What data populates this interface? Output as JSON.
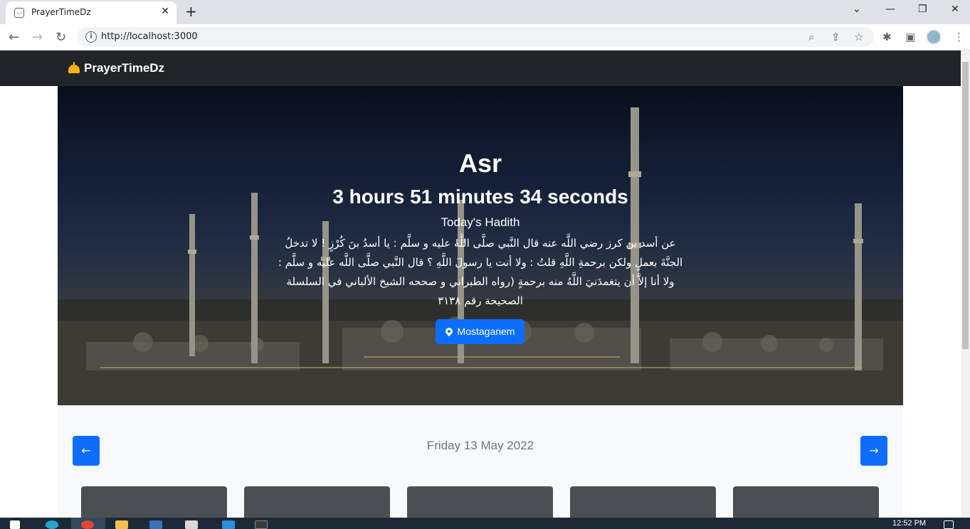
{
  "browser": {
    "tab_title": "PrayerTimeDz",
    "url": "http://localhost:3000"
  },
  "navbar": {
    "brand": "PrayerTimeDz"
  },
  "hero": {
    "prayer_name": "Asr",
    "countdown": "3 hours 51 minutes 34 seconds",
    "hadith_title": "Today's Hadith",
    "hadith_text": "عن أسد بن كرز رضي اللَّه عنه قال النَّبي صلَّى اللَّه عليه و سلَّم : يا أسدُ بنَ كُرْزٍ ! لا تدخلُ الجنَّةَ بعملٍ ولكن برحمةِ اللَّهِ قلتُ : ولا أنت يا رسولَ اللَّهِ ؟ قال النَّبي صلَّى اللَّه عليه و سلَّم : ولا أنا إلاَّ أن يتغمدَنيَ اللَّهُ منه برحمةٍ (رواه الطبراني و صححه الشيخ الألباني في السلسلة الصحيحة رقم ٣١٣٨",
    "location_button": "Mostaganem"
  },
  "schedule": {
    "date": "Friday 13 May 2022",
    "prev_icon": "arrow-left-icon",
    "next_icon": "arrow-right-icon",
    "cards_count_visible": 5
  },
  "taskbar": {
    "time": "12:52 PM"
  },
  "colors": {
    "navbar": "#212529",
    "primary": "#0d6efd",
    "section_bg": "#f8f9fa",
    "card": "#4b4f54"
  }
}
